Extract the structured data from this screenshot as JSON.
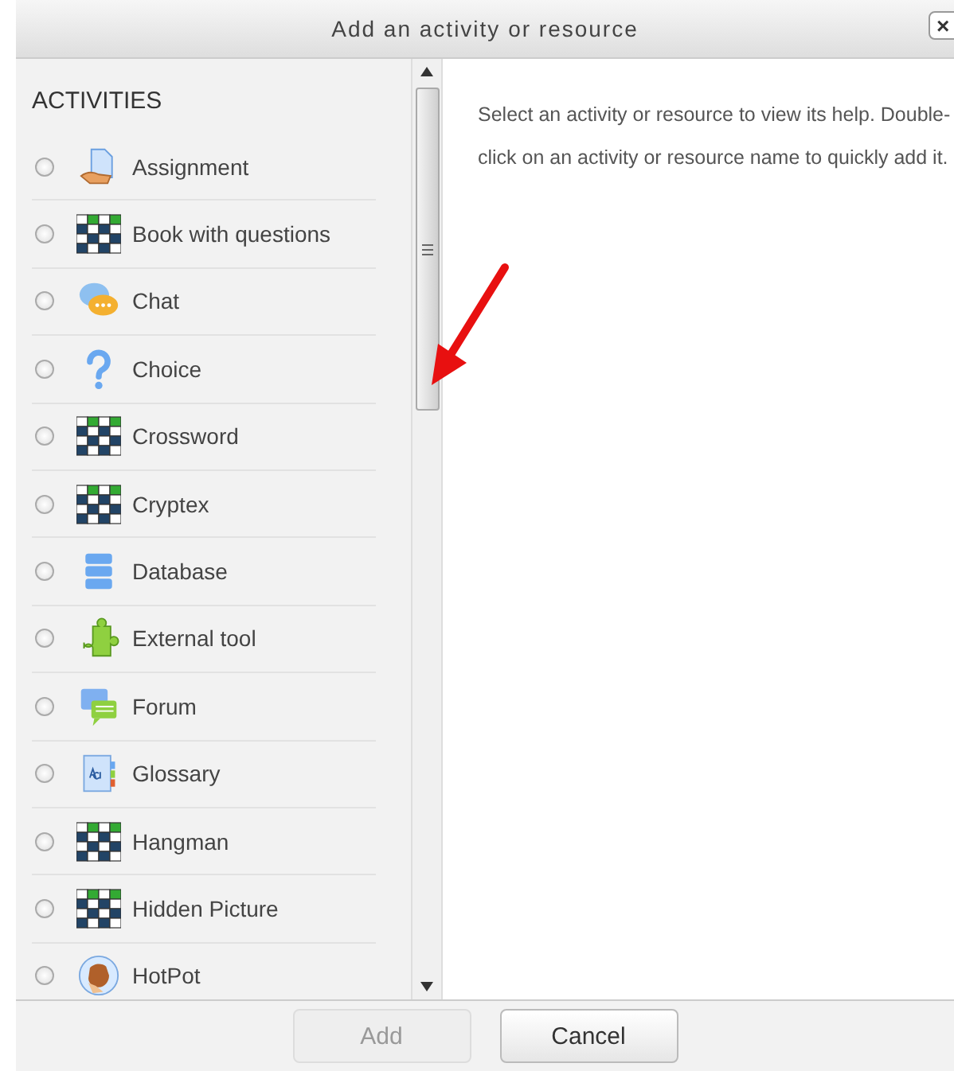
{
  "window": {
    "title": "Add an activity or resource",
    "close": "×"
  },
  "activities": {
    "heading": "ACTIVITIES",
    "items": [
      {
        "label": "Assignment",
        "kind": "assignment",
        "selected": false
      },
      {
        "label": "Book with questions",
        "kind": "board",
        "selected": false
      },
      {
        "label": "Chat",
        "kind": "chat",
        "selected": false
      },
      {
        "label": "Choice",
        "kind": "question",
        "selected": false
      },
      {
        "label": "Crossword",
        "kind": "board",
        "selected": false
      },
      {
        "label": "Cryptex",
        "kind": "board",
        "selected": false
      },
      {
        "label": "Database",
        "kind": "database",
        "selected": false
      },
      {
        "label": "External tool",
        "kind": "puzzle",
        "selected": false
      },
      {
        "label": "Forum",
        "kind": "forum",
        "selected": false
      },
      {
        "label": "Glossary",
        "kind": "glossary",
        "selected": false
      },
      {
        "label": "Hangman",
        "kind": "board",
        "selected": false
      },
      {
        "label": "Hidden Picture",
        "kind": "board",
        "selected": false
      },
      {
        "label": "HotPot",
        "kind": "hand",
        "selected": false
      }
    ]
  },
  "help": {
    "text": "Select an activity or resource to view its help. Double-click on an activity or resource name to quickly add it."
  },
  "buttons": [
    {
      "label": "Add",
      "disabled": true
    },
    {
      "label": "Cancel",
      "disabled": false
    }
  ]
}
